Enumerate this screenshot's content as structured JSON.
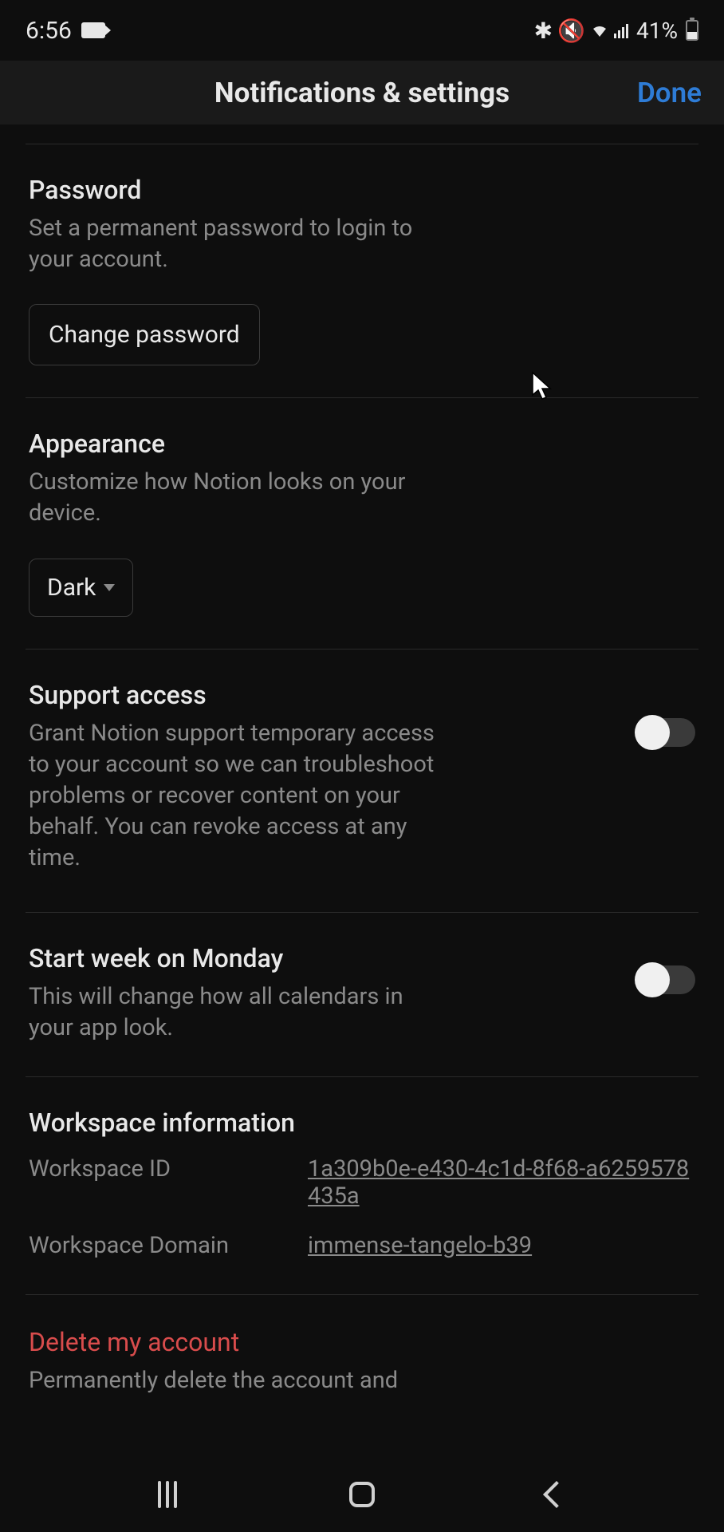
{
  "status_bar": {
    "time": "6:56",
    "icons_text": "✱ ⋊ᴵ ᯤ ᴵıl",
    "battery": "41%"
  },
  "header": {
    "title": "Notifications & settings",
    "done": "Done"
  },
  "password": {
    "title": "Password",
    "description": "Set a permanent password to login to your account.",
    "button": "Change password"
  },
  "appearance": {
    "title": "Appearance",
    "description": "Customize how Notion looks on your device.",
    "value": "Dark"
  },
  "support": {
    "title": "Support access",
    "description": "Grant Notion support temporary access to your account so we can troubleshoot problems or recover content on your behalf. You can revoke access at any time.",
    "enabled": false
  },
  "start_week": {
    "title": "Start week on Monday",
    "description": "This will change how all calendars in your app look.",
    "enabled": false
  },
  "workspace": {
    "title": "Workspace information",
    "id_label": "Workspace ID",
    "id_value": "1a309b0e-e430-4c1d-8f68-a6259578435a",
    "domain_label": "Workspace Domain",
    "domain_value": "immense-tangelo-b39"
  },
  "delete": {
    "title": "Delete my account",
    "description": "Permanently delete the account and"
  }
}
